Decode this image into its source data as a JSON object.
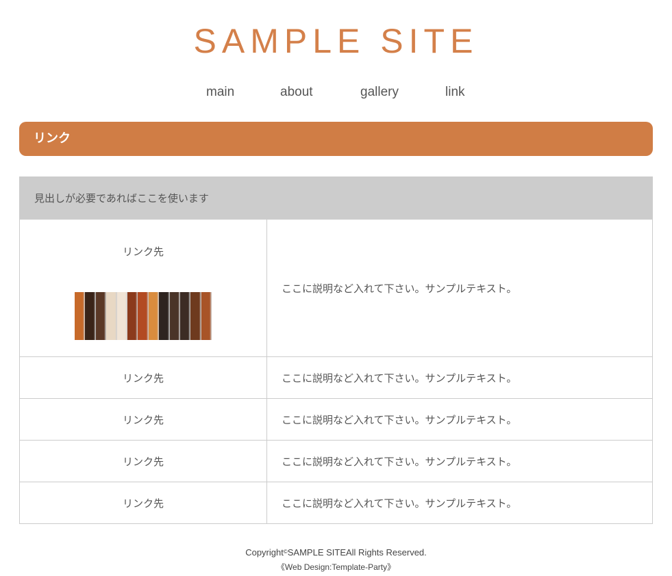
{
  "site": {
    "logo": "SAMPLE SITE"
  },
  "nav": {
    "items": [
      "main",
      "about",
      "gallery",
      "link"
    ]
  },
  "page": {
    "heading": "リンク"
  },
  "table": {
    "header": "見出しが必要であればここを使います",
    "rows": [
      {
        "link": "リンク先",
        "description": "ここに説明など入れて下さい。サンプルテキスト。"
      },
      {
        "link": "リンク先",
        "description": "ここに説明など入れて下さい。サンプルテキスト。"
      },
      {
        "link": "リンク先",
        "description": "ここに説明など入れて下さい。サンプルテキスト。"
      },
      {
        "link": "リンク先",
        "description": "ここに説明など入れて下さい。サンプルテキスト。"
      },
      {
        "link": "リンク先",
        "description": "ここに説明など入れて下さい。サンプルテキスト。"
      }
    ]
  },
  "footer": {
    "copyright_prefix": "Copyright",
    "copyright_mark": "©",
    "copyright_rest": "SAMPLE SITEAll Rights Reserved.",
    "credit": "《Web Design:Template-Party》"
  },
  "colors": {
    "accent": "#d07d45",
    "logo": "#d4804a",
    "table_header_bg": "#cccccc",
    "border": "#cccccc"
  },
  "thumbnail": {
    "name": "wood-planks-image",
    "planks": [
      "#c76a2a",
      "#3a2418",
      "#5a3826",
      "#e8d8c4",
      "#f0e4d6",
      "#8b3a1c",
      "#b24a22",
      "#d98c3e",
      "#2e2420",
      "#4a3428",
      "#3c2c24",
      "#6e3a1e",
      "#a85428"
    ]
  }
}
